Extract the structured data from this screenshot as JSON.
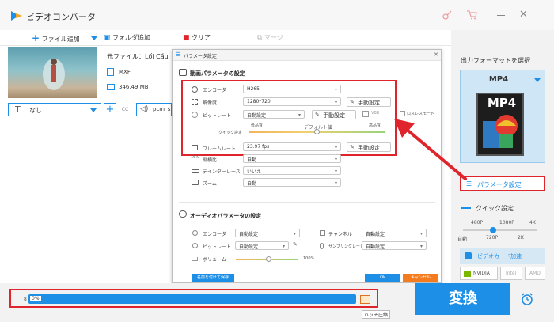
{
  "title": "ビデオコンバータ",
  "toolbar": {
    "add_file": "ファイル追加",
    "add_folder": "フォルダ追加",
    "clear": "クリア",
    "merge": "マージ"
  },
  "file": {
    "source_label": "元ファイル：",
    "source_name": "Lối Cầu",
    "format": "MXF",
    "size": "346.49 MB",
    "subtitle_value": "なし",
    "audio_value": "pcm_s"
  },
  "dialog": {
    "title": "パラメータ設定",
    "video_section": "動画パラメータの設定",
    "encoder_label": "エンコーダ",
    "encoder_value": "H265",
    "resolution_label": "解像度",
    "resolution_value": "1280*720",
    "bitrate_label": "ビットレート",
    "bitrate_value": "自動設定",
    "vbr_label": "VBR",
    "lossless_label": "ロスレスモード",
    "quick_label": "クイック設定",
    "quality_low": "低品質",
    "quality_default": "デフォルト値",
    "quality_high": "高品質",
    "framerate_label": "フレームレート",
    "framerate_value": "23.97 fps",
    "aspect_label": "縦横比",
    "aspect_value": "自動",
    "deinterlace_label": "デインターレース",
    "deinterlace_value": "いいえ",
    "zoom_label": "ズーム",
    "zoom_value": "自動",
    "manual_button": "手動設定",
    "audio_section": "オーディオパラメータの設定",
    "a_encoder_label": "エンコーダ",
    "a_encoder_value": "自動設定",
    "a_bitrate_label": "ビットレート",
    "a_bitrate_value": "自動設定",
    "a_volume_label": "ボリューム",
    "a_volume_value": "100%",
    "a_channel_label": "チャンネル",
    "a_channel_value": "自動設定",
    "a_sample_label": "サンプリングレート",
    "a_sample_value": "自動設定",
    "save_as": "名前を付けて保存",
    "ok": "Ok",
    "cancel": "キャンセル"
  },
  "right": {
    "output_label": "出力フォーマットを選択",
    "format": "MP4",
    "format_icon_text": "MP4",
    "param_button": "パラメータ設定",
    "quick_title": "クイック設定",
    "q_top": [
      "480P",
      "1080P",
      "4K"
    ],
    "q_bottom": [
      "自動",
      "720P",
      "2K"
    ],
    "gpu_label": "ビデオカード加速",
    "nvidia": "NVIDIA",
    "intel": "Intel",
    "amd": "AMD"
  },
  "bottom": {
    "progress_text": "0%",
    "progress_value": 0,
    "batch_label": "バッチ圧縮",
    "convert": "変換"
  },
  "colors": {
    "accent": "#1e8fe6",
    "highlight": "#e0242c",
    "cancel": "#f47c1f"
  }
}
